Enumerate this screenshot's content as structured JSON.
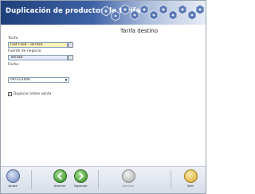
{
  "title": "Duplicación de productos de tarifas.",
  "section_title": "Tarifa destino",
  "form": {
    "tarifa_label": "Tarifa",
    "tarifa_value": "Fast Food - Terraza",
    "fuente_label": "Fuente de negocio",
    "fuente_value": "Terraza",
    "fecha_label": "Fecha",
    "fecha_value": "09/11/2006",
    "duplicar_label": "Duplicar orden venta",
    "lookup_symbol": "...",
    "dropdown_symbol": "▼"
  },
  "footer": {
    "ayuda": "Ayuda",
    "anterior": "Anterior",
    "siguiente": "Siguiente",
    "ejecutar": "Ejecutar",
    "salir": "Salir"
  },
  "colors": {
    "title_dark": "#1f3f7a",
    "tarifa_bg": "#fff3b8",
    "fuente_bg": "#e6e9f7",
    "nav_green": "#3a9a2c",
    "exit_yellow": "#e0b93a"
  }
}
